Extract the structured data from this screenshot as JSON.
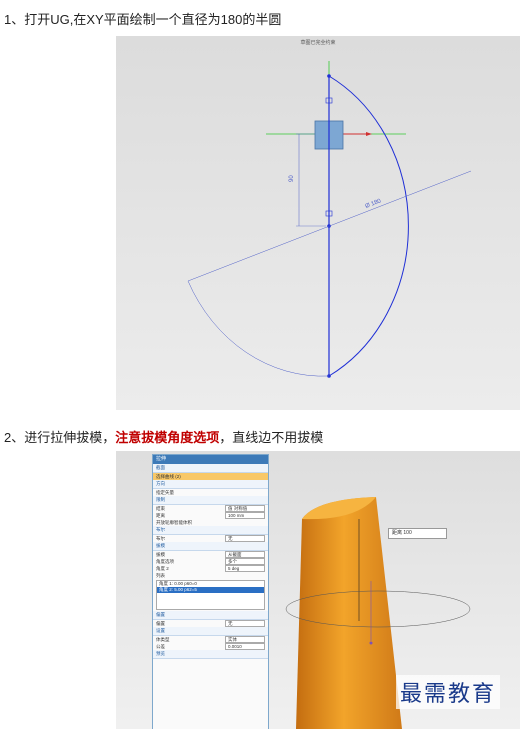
{
  "steps": {
    "step1": "1、打开UG,在XY平面绘制一个直径为180的半圆",
    "step2_prefix": "2、进行拉伸拔模，",
    "step2_highlight": "注意拔模角度选项",
    "step2_suffix": "，直线边不用拔模"
  },
  "screenshot1": {
    "caption": "草图已完全约束",
    "dim_vertical": "90",
    "dim_diameter": "Ø 180"
  },
  "screenshot2": {
    "panel_title": "拉伸",
    "sections": {
      "section": "截面",
      "select_curve": "选择曲线 (2)",
      "direction": "方向",
      "specify_vector": "指定矢量",
      "limits": "限制",
      "start_label": "结束",
      "start_value": "值 对称值",
      "distance_label": "距离",
      "distance_value": "100",
      "distance_unit": "mm",
      "open_profile": "开放轮廓智能体积",
      "boolean": "布尔",
      "boolean_label": "布尔",
      "boolean_value": "无",
      "draft": "拔模",
      "draft_label": "拔模",
      "draft_value": "从截面",
      "angle_option_label": "角度选项",
      "angle_option_value": "多个",
      "angle_label": "角度 2",
      "angle_value": "5",
      "angle_unit": "deg",
      "list_header": "列表",
      "list_item1": "角度 1: 0.00  p60=0",
      "list_item2": "角度 2: 5.00  p62=5",
      "offset": "偏置",
      "offset_label": "偏置",
      "offset_value": "无",
      "settings": "设置",
      "body_type_label": "体类型",
      "body_type_value": "实体",
      "tolerance_label": "公差",
      "tolerance_value": "0.0010",
      "preview": "预览"
    },
    "tooltip": "距离 100",
    "watermark": "最需教育"
  },
  "colors": {
    "sketch_line": "#1f2fd6",
    "solid": "#f0a020",
    "highlight_red": "#c00000"
  }
}
